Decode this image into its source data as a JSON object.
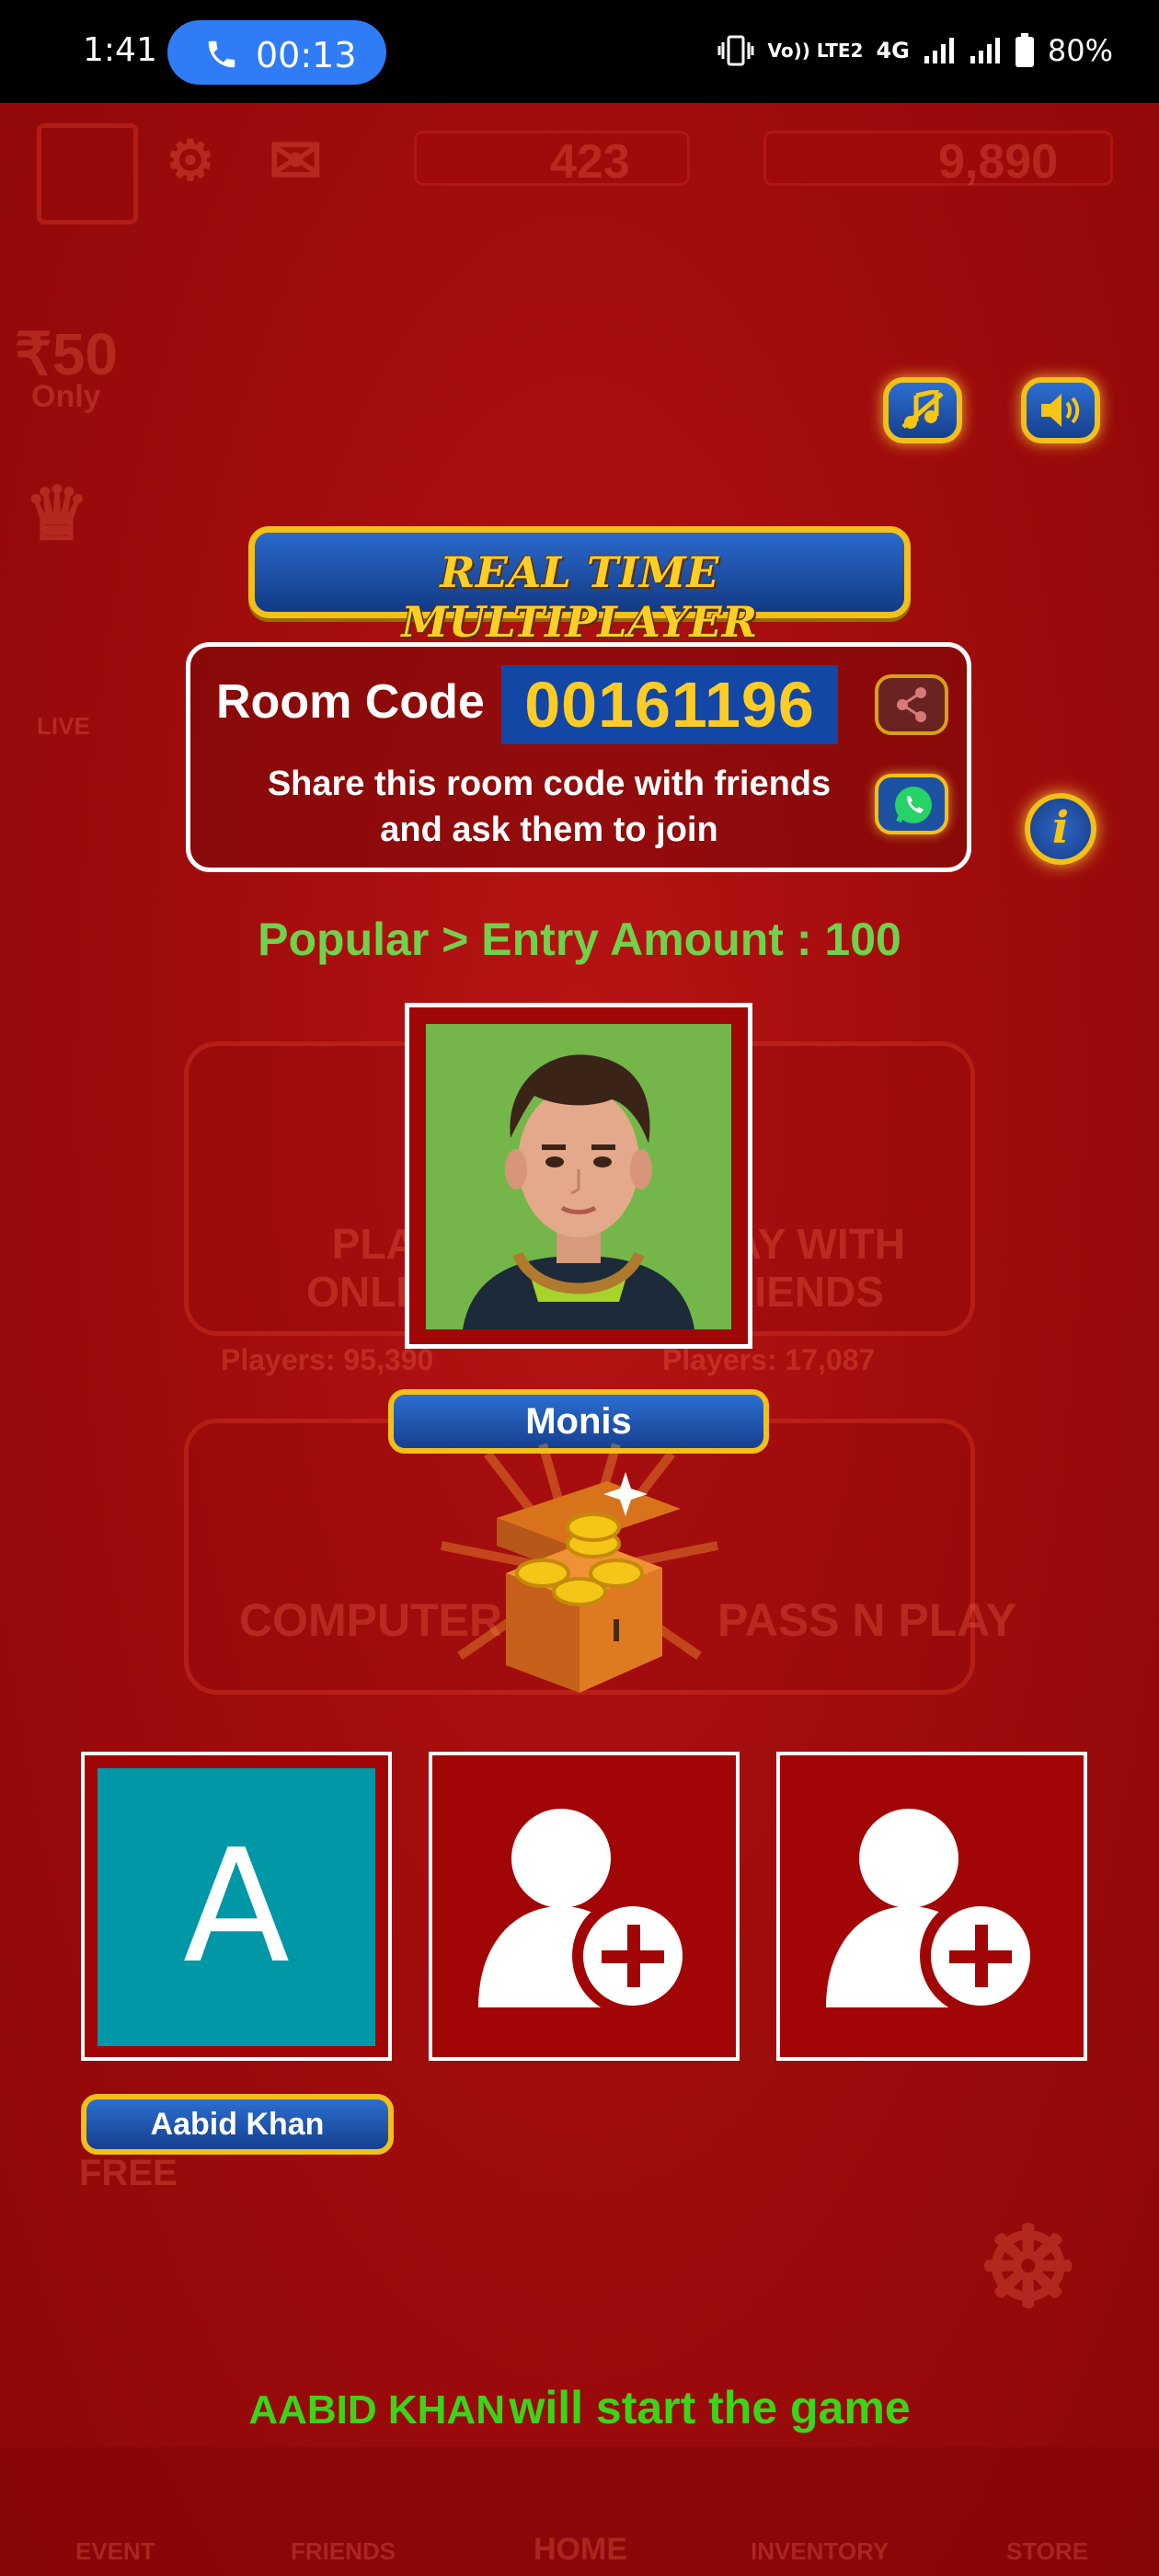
{
  "status_bar": {
    "time": "1:41",
    "call_timer": "00:13",
    "net_label": "4G",
    "volte_label": "Vo)) LTE2",
    "battery": "80%"
  },
  "background": {
    "coins": "423",
    "gems": "9,890",
    "promo_price": "₹50",
    "promo_only": "Only",
    "live_label": "LIVE",
    "play_online": "PLAY ONLINE",
    "play_friends": "PLAY WITH FRIENDS",
    "players_online": "Players: 95,390",
    "players_friends": "Players: 17,087",
    "computer": "COMPUTER",
    "pass_n_play": "PASS N PLAY",
    "free_label": "FREE",
    "nav": [
      "EVENT",
      "FRIENDS",
      "HOME",
      "INVENTORY",
      "STORE"
    ]
  },
  "banner": {
    "title": "REAL TIME MULTIPLAYER"
  },
  "room": {
    "label": "Room Code :",
    "code": "00161196",
    "share_line1": "Share this room code with friends",
    "share_line2": "and ask them to join"
  },
  "entry_text": "Popular > Entry Amount : 100",
  "host": {
    "name": "Monis"
  },
  "players": {
    "slot1_initial": "A",
    "slot1_name": "Aabid Khan"
  },
  "start_message": {
    "name": "AABID KHAN",
    "rest": "will start the game"
  },
  "colors": {
    "background": "#a10c0c",
    "accent_gold": "#f3c019",
    "button_blue": "#1d52a3",
    "highlight_green": "#6fd24b",
    "avatar_teal": "#0097a7"
  }
}
